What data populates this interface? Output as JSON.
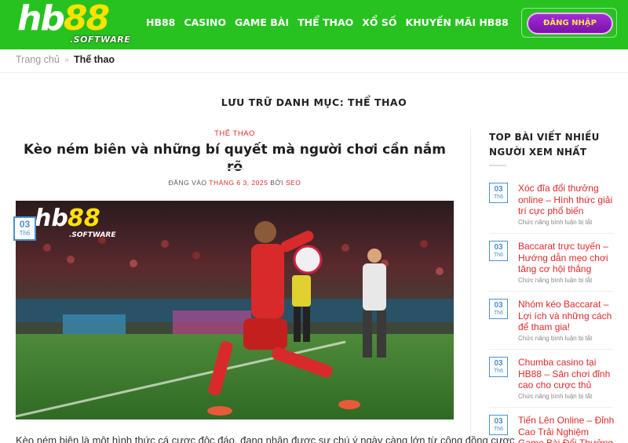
{
  "header": {
    "logo_main_white": "hb",
    "logo_main_yellow": "88",
    "logo_sub": ".SOFTWARE",
    "nav": [
      "HB88",
      "CASINO",
      "GAME BÀI",
      "THỂ THAO",
      "XỔ SỐ",
      "KHUYẾN MÃI HB88"
    ],
    "login_label": "ĐĂNG NHẬP"
  },
  "breadcrumb": {
    "home": "Trang chủ",
    "separator": "»",
    "current": "Thể thao"
  },
  "archive_title": "LƯU TRỮ DANH MỤC: THỂ THAO",
  "post": {
    "category": "THỂ THAO",
    "title": "Kèo ném biên và những bí quyết mà người chơi cần nắm rõ",
    "meta_prefix": "ĐĂNG VÀO",
    "meta_date": "THÁNG 6 3, 2025",
    "meta_by": "BỞI",
    "meta_author": "SEO",
    "badge_day": "03",
    "badge_month": "Th6",
    "image_logo_white": "hb",
    "image_logo_yellow": "88",
    "image_logo_sub": ".SOFTWARE",
    "excerpt": "Kèo ném biên là một hình thức cá cược độc đáo, đang nhận được sự chú ý ngày càng lớn từ cộng đồng cược"
  },
  "sidebar": {
    "title_line1": "TOP BÀI VIẾT NHIỀU",
    "title_line2": "NGƯỜI XEM NHẤT",
    "items": [
      {
        "day": "03",
        "month": "Th6",
        "title": "Xóc đĩa đổi thưởng online – Hình thức giải trí cực phổ biến",
        "sub": "Chức năng bình luận bị tắt"
      },
      {
        "day": "03",
        "month": "Th6",
        "title": "Baccarat trực tuyến – Hướng dẫn mẹo chơi tăng cơ hội thắng",
        "sub": "Chức năng bình luận bị tắt"
      },
      {
        "day": "03",
        "month": "Th6",
        "title": "Nhóm kéo Baccarat – Lợi ích và những cách để tham gia!",
        "sub": "Chức năng bình luận bị tắt"
      },
      {
        "day": "03",
        "month": "Th6",
        "title": "Chumba casino tại HB88 – Sân chơi đỉnh cao cho cược thủ",
        "sub": "Chức năng bình luận bị tắt"
      },
      {
        "day": "03",
        "month": "Th6",
        "title": "Tiến Lên Online – Đỉnh Cao Trải Nghiệm Game Bài Đổi Thưởng",
        "sub": ""
      }
    ]
  },
  "colors": {
    "header_green": "#27c21f",
    "accent_red": "#e0292b",
    "badge_blue": "#4a90d9",
    "login_purple": "#8a1fb8",
    "logo_yellow": "#ffe200"
  }
}
